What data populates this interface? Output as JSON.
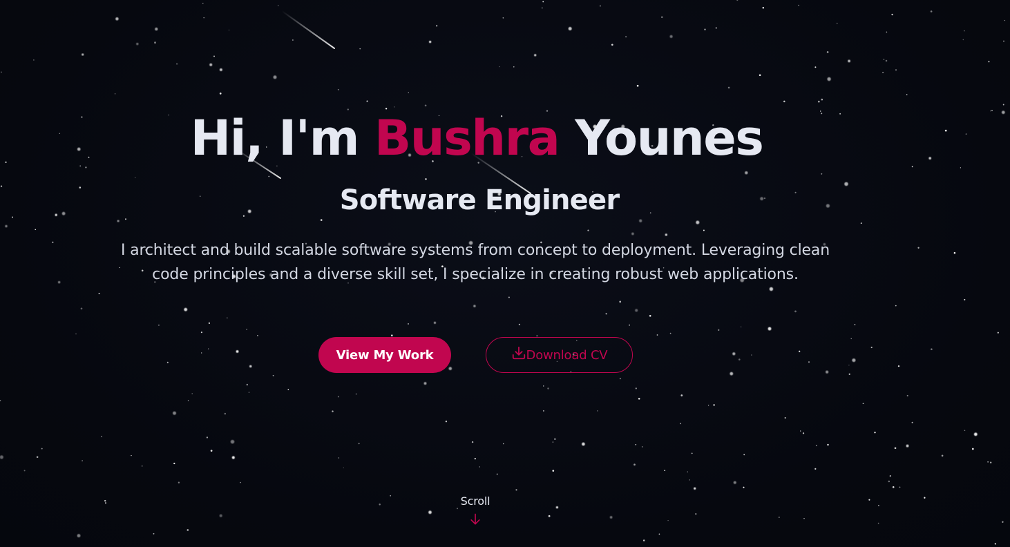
{
  "hero": {
    "greeting": "Hi, I'm ",
    "first_name": "Bushra",
    "last_name": " Younes",
    "role": "Software Engineer",
    "description": "I architect and build scalable software systems from concept to deployment. Leveraging clean code principles and a diverse skill set, I specialize in creating robust web applications."
  },
  "actions": {
    "primary_label": "View My Work",
    "secondary_label": "Download CV",
    "secondary_icon": "download-icon"
  },
  "scroll": {
    "label": "Scroll",
    "icon": "arrow-down-icon"
  },
  "colors": {
    "background": "#06080f",
    "accent": "#c1064f",
    "text": "#e6e9f2",
    "star": "#ffffff"
  }
}
